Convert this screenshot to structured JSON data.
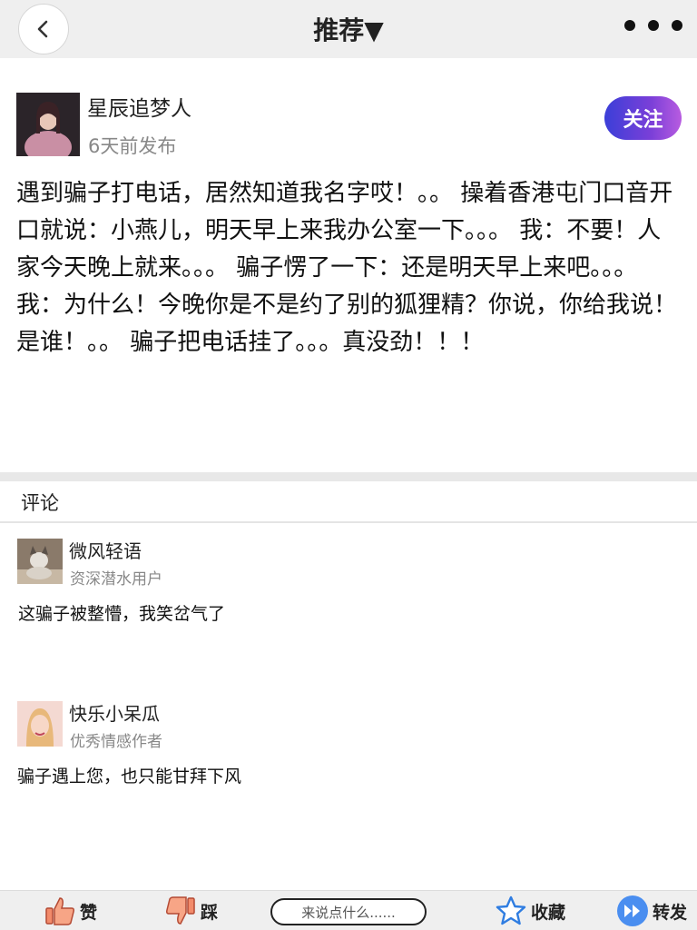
{
  "header": {
    "title": "推荐▼"
  },
  "post": {
    "author_name": "星辰追梦人",
    "time": "6天前发布",
    "follow_label": "关注",
    "body": "遇到骗子打电话，居然知道我名字哎！。。 操着香港屯门口音开口就说：小燕儿，明天早上来我办公室一下。。。 我：不要！人家今天晚上就来。。。 骗子愣了一下：还是明天早上来吧。。。 我：为什么！今晚你是不是约了别的狐狸精？你说，你给我说！是谁！。。 骗子把电话挂了。。。真没劲！！！"
  },
  "comments": {
    "title": "评论",
    "items": [
      {
        "name": "微风轻语",
        "role": "资深潜水用户",
        "text": "这骗子被整懵，我笑岔气了"
      },
      {
        "name": "快乐小呆瓜",
        "role": "优秀情感作者",
        "text": "骗子遇上您，也只能甘拜下风"
      }
    ]
  },
  "bottom_bar": {
    "like_label": "赞",
    "dislike_label": "踩",
    "input_placeholder": "来说点什么......",
    "favorite_label": "收藏",
    "share_label": "转发"
  },
  "colors": {
    "accent_start": "#3b3fd8",
    "accent_end": "#b85ce0",
    "like": "#f28b6b",
    "star": "#2f7de1",
    "share": "#4a8ef0"
  }
}
